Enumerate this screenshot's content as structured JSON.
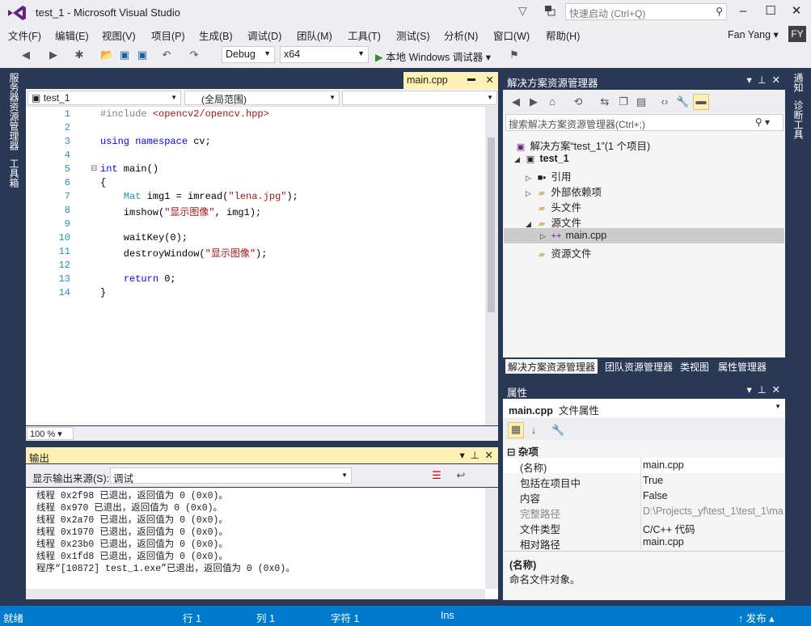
{
  "window": {
    "title": "test_1 - Microsoft Visual Studio",
    "quick_launch_placeholder": "快速启动 (Ctrl+Q)",
    "min": "–",
    "max": "☐",
    "close": "✕"
  },
  "menu": [
    "文件(F)",
    "编辑(E)",
    "视图(V)",
    "项目(P)",
    "生成(B)",
    "调试(D)",
    "团队(M)",
    "工具(T)",
    "测试(S)",
    "分析(N)",
    "窗口(W)",
    "帮助(H)"
  ],
  "user": {
    "name": "Fan Yang",
    "initials": "FY"
  },
  "toolbar": {
    "config": "Debug",
    "platform": "x64",
    "run_label": "本地 Windows 调试器"
  },
  "left_tabs": [
    "服务器资源管理器",
    "工具箱"
  ],
  "right_tabs": [
    "通知",
    "诊断工具"
  ],
  "editor": {
    "tab": "main.cpp",
    "nav": {
      "project": "test_1",
      "scope": "(全局范围)",
      "member": ""
    },
    "zoom": "100 %",
    "lines": [
      "1",
      "2",
      "3",
      "4",
      "5",
      "6",
      "7",
      "8",
      "9",
      "10",
      "11",
      "12",
      "13",
      "14"
    ]
  },
  "output": {
    "title": "输出",
    "source_label": "显示输出来源(S):",
    "source_value": "调试",
    "lines": [
      "线程 0x2f98 已退出，返回值为 0 (0x0)。",
      "线程 0x970 已退出，返回值为 0 (0x0)。",
      "线程 0x2a70 已退出，返回值为 0 (0x0)。",
      "线程 0x1970 已退出，返回值为 0 (0x0)。",
      "线程 0x23b0 已退出，返回值为 0 (0x0)。",
      "线程 0x1fd8 已退出，返回值为 0 (0x0)。",
      "程序“[10872] test_1.exe”已退出，返回值为 0 (0x0)。"
    ]
  },
  "solution_explorer": {
    "title": "解决方案资源管理器",
    "search_placeholder": "搜索解决方案资源管理器(Ctrl+;)",
    "solution": "解决方案“test_1”(1 个项目)",
    "project": "test_1",
    "items": [
      "引用",
      "外部依赖项",
      "头文件",
      "源文件",
      "main.cpp",
      "资源文件"
    ],
    "tabs": [
      "解决方案资源管理器",
      "团队资源管理器",
      "类视图",
      "属性管理器"
    ]
  },
  "properties": {
    "title": "属性",
    "object_name": "main.cpp",
    "object_type": "文件属性",
    "category": "杂项",
    "rows": [
      {
        "k": "(名称)",
        "v": "main.cpp"
      },
      {
        "k": "包括在项目中",
        "v": "True"
      },
      {
        "k": "内容",
        "v": "False"
      },
      {
        "k": "完整路径",
        "v": "D:\\Projects_yf\\test_1\\test_1\\ma"
      },
      {
        "k": "文件类型",
        "v": "C/C++ 代码"
      },
      {
        "k": "相对路径",
        "v": "main.cpp"
      }
    ],
    "desc_title": "(名称)",
    "desc_text": "命名文件对象。"
  },
  "status": {
    "ready": "就绪",
    "row": "行 1",
    "col": "列 1",
    "char": "字符 1",
    "ins": "Ins",
    "publish": "发布"
  }
}
